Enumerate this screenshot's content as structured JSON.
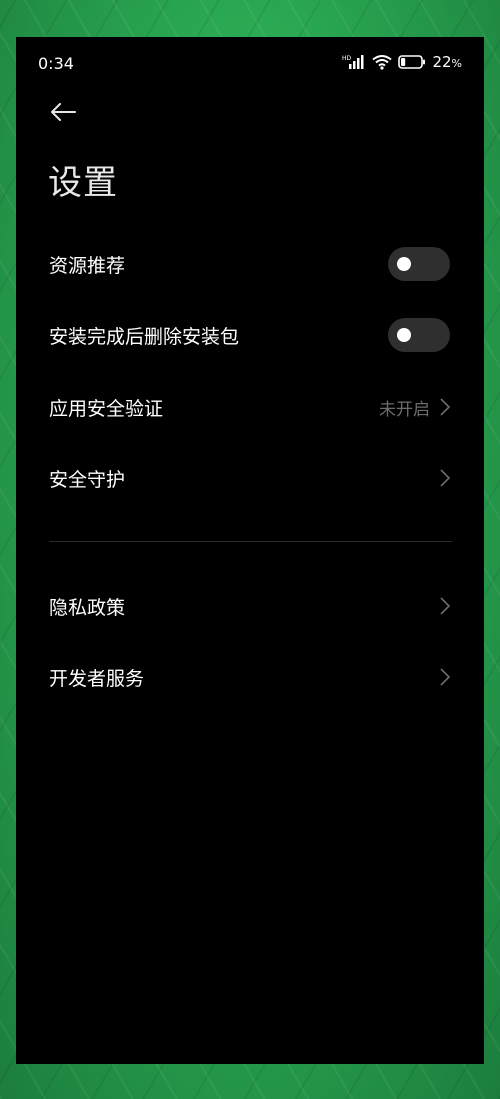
{
  "status_bar": {
    "time": "0:34",
    "network_badge": "HD",
    "battery_percent": "22",
    "battery_unit": "%",
    "battery_level": 0.22,
    "icons": [
      "hd-signal-icon",
      "wifi-icon",
      "battery-icon"
    ]
  },
  "header": {
    "back_icon": "arrow-left-icon",
    "title": "设置"
  },
  "settings": {
    "resource_recommend": {
      "label": "资源推荐",
      "enabled": false
    },
    "delete_package_after_install": {
      "label": "安装完成后删除安装包",
      "enabled": false
    },
    "app_security_verify": {
      "label": "应用安全验证",
      "value": "未开启"
    },
    "security_guard": {
      "label": "安全守护"
    },
    "privacy_policy": {
      "label": "隐私政策"
    },
    "developer_service": {
      "label": "开发者服务"
    }
  },
  "colors": {
    "screen_background": "#000000",
    "text_primary": "#ffffff",
    "text_secondary": "#6c6c6c",
    "toggle_off_track": "#2f2f2f",
    "backdrop_green": "#2aa852"
  }
}
